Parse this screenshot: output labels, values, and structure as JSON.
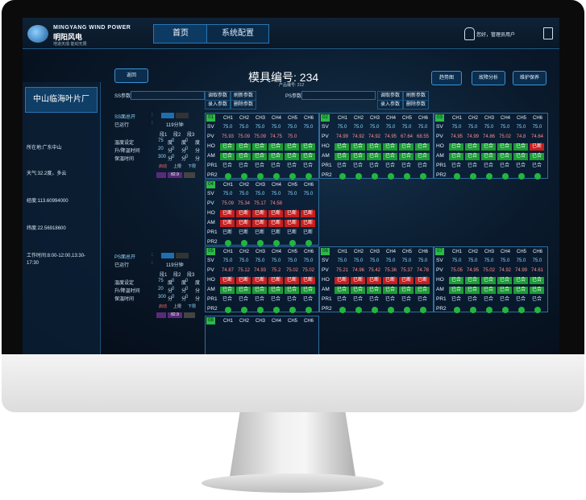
{
  "brand": {
    "en": "MINGYANG WIND POWER",
    "cn": "明阳风电",
    "slogan": "地道天成·能动无限"
  },
  "nav": {
    "tab_home": "首页",
    "tab_config": "系统配置",
    "user_text": "您好，管理员用户"
  },
  "sidebar": {
    "title": "中山临海叶片厂",
    "location": "所在地:广东中山",
    "weather": "天气:32.2度，多云",
    "longitude": "经度:113.60994000",
    "latitude": "纬度:22.56918600",
    "hours": "工作时间:8:00-12:00,13:30-17:30"
  },
  "header": {
    "back": "返回",
    "mold_label": "模具编号:",
    "mold_value": "234",
    "product_label": "产品编号:",
    "product_value": "212",
    "trend": "趋势图",
    "fault": "故障分析",
    "maint": "维护保养"
  },
  "params": {
    "ss_label": "SS参数:",
    "ps_label": "PS参数:",
    "read": "调取参数",
    "refresh": "刷新参数",
    "enter": "录入参数",
    "delete": "删除参数"
  },
  "control": {
    "ss_total": "SS面总开",
    "ps_total": "PS面总开",
    "colon": ":",
    "elapsed_label": "已运行",
    "colon2": ":",
    "elapsed_value": "119分钟",
    "stage1": "段1",
    "stage2": "段2",
    "stage3": "段3",
    "temp_label": "温度设定",
    "ramp_label": "升/降温时间",
    "hold_label": "保温时间",
    "temp_vals": [
      "75",
      "0",
      "0"
    ],
    "ramp_vals": [
      "20",
      "0",
      "0"
    ],
    "hold_vals": [
      "300",
      "0",
      "0"
    ],
    "units_temp": [
      "度",
      "度",
      "度"
    ],
    "units_min": [
      "分",
      "分",
      "分"
    ],
    "units_min2": [
      "分",
      "分",
      "分"
    ],
    "start": "启动",
    "up": "上限",
    "down": "下限",
    "ss_vals": [
      "82.9"
    ],
    "ps_vals": [
      "82.9"
    ]
  },
  "channels": [
    "CH1",
    "CH2",
    "CH3",
    "CH4",
    "CH5",
    "CH6"
  ],
  "row_labels": [
    "SV",
    "PV",
    "HO",
    "AM",
    "PR1",
    "PR2"
  ],
  "state": {
    "closed": "已合",
    "open": "已断"
  },
  "panels": [
    {
      "id": "01",
      "sv": [
        "75.0",
        "75.0",
        "75.0",
        "75.0",
        "75.0",
        "75.0"
      ],
      "pv": [
        "75.93",
        "75.09",
        "75.09",
        "74.75",
        "75.0",
        ""
      ],
      "ho": [
        "g",
        "g",
        "g",
        "g",
        "g",
        "g"
      ],
      "am": [
        "g",
        "g",
        "g",
        "g",
        "g",
        "g"
      ],
      "pr1": [
        "g",
        "g",
        "g",
        "g",
        "g",
        "g"
      ]
    },
    {
      "id": "02",
      "sv": [
        "75.0",
        "75.0",
        "75.0",
        "75.0",
        "75.0",
        "75.0"
      ],
      "pv": [
        "74.99",
        "74.92",
        "74.92",
        "74.95",
        "67.64",
        "68.55"
      ],
      "ho": [
        "g",
        "g",
        "g",
        "g",
        "g",
        "g"
      ],
      "am": [
        "g",
        "g",
        "g",
        "g",
        "g",
        "g"
      ],
      "pr1": [
        "g",
        "g",
        "g",
        "g",
        "g",
        "g"
      ]
    },
    {
      "id": "03",
      "sv": [
        "75.0",
        "75.0",
        "75.0",
        "75.0",
        "75.0",
        "75.0"
      ],
      "pv": [
        "74.95",
        "74.99",
        "74.86",
        "75.02",
        "74.8",
        "74.64"
      ],
      "ho": [
        "g",
        "g",
        "g",
        "g",
        "g",
        "r"
      ],
      "am": [
        "g",
        "g",
        "g",
        "g",
        "g",
        "g"
      ],
      "pr1": [
        "g",
        "g",
        "g",
        "g",
        "g",
        "g"
      ]
    },
    {
      "id": "04",
      "sv": [
        "75.0",
        "75.0",
        "75.0",
        "75.0",
        "75.0",
        "75.0"
      ],
      "pv": [
        "75.09",
        "75.34",
        "75.17",
        "74.58",
        "",
        ""
      ],
      "ho": [
        "r",
        "r",
        "r",
        "r",
        "r",
        "r"
      ],
      "am": [
        "r",
        "r",
        "r",
        "r",
        "r",
        "r"
      ],
      "pr1": [
        "r",
        "r",
        "r",
        "r",
        "r",
        "r"
      ]
    },
    {
      "id": "05",
      "sv": [
        "75.0",
        "75.0",
        "75.0",
        "75.0",
        "75.0",
        "75.0"
      ],
      "pv": [
        "74.87",
        "75.12",
        "74.93",
        "75.2",
        "75.02",
        "75.02"
      ],
      "ho": [
        "r",
        "r",
        "r",
        "r",
        "r",
        "r"
      ],
      "am": [
        "g",
        "g",
        "g",
        "g",
        "g",
        "g"
      ],
      "pr1": [
        "g",
        "g",
        "g",
        "g",
        "g",
        "g"
      ]
    },
    {
      "id": "06",
      "sv": [
        "75.0",
        "75.0",
        "75.0",
        "75.0",
        "75.0",
        "75.0"
      ],
      "pv": [
        "75.21",
        "74.96",
        "75.42",
        "75.36",
        "75.37",
        "74.78"
      ],
      "ho": [
        "r",
        "r",
        "r",
        "r",
        "r",
        "r"
      ],
      "am": [
        "g",
        "g",
        "g",
        "g",
        "g",
        "g"
      ],
      "pr1": [
        "g",
        "g",
        "g",
        "g",
        "g",
        "g"
      ]
    },
    {
      "id": "07",
      "sv": [
        "75.0",
        "75.0",
        "75.0",
        "75.0",
        "75.0",
        "75.0"
      ],
      "pv": [
        "75.05",
        "74.95",
        "75.02",
        "74.92",
        "74.99",
        "74.61"
      ],
      "ho": [
        "g",
        "g",
        "g",
        "g",
        "g",
        "g"
      ],
      "am": [
        "g",
        "g",
        "g",
        "g",
        "g",
        "g"
      ],
      "pr1": [
        "g",
        "g",
        "g",
        "g",
        "g",
        "g"
      ]
    },
    {
      "id": "08",
      "sv": [],
      "pv": [],
      "ho": [],
      "am": [],
      "pr1": []
    }
  ],
  "colors": {
    "accent": "#2b76b0",
    "ok": "#1c9c36",
    "alarm": "#c81e1e"
  }
}
